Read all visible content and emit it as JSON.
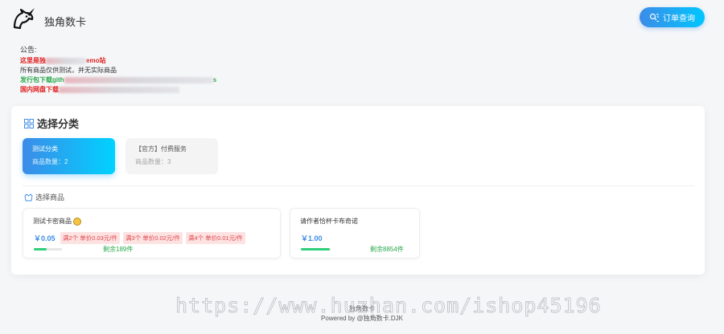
{
  "header": {
    "site_name": "独角数卡",
    "order_button": "订单查询"
  },
  "notice": {
    "title": "公告:",
    "lines": [
      {
        "start": "这里是独",
        "end": "emo站"
      },
      {
        "start": "所有商品仅供测试，并无实际商品",
        "end": ""
      },
      {
        "start": "发行包下载gith",
        "end": "s"
      },
      {
        "start": "国内网盘下载",
        "end": ""
      }
    ]
  },
  "categories": {
    "title": "选择分类",
    "items": [
      {
        "name": "测试分类",
        "count": "商品数量：2"
      },
      {
        "name": "【官方】付费服务",
        "count": "商品数量：3"
      }
    ]
  },
  "goods": {
    "title": "选择商品",
    "items": [
      {
        "name": "测试卡密商品",
        "price": "￥0.05",
        "tags": [
          "满2个 单价0.03元/件",
          "满3个 单价0.02元/件",
          "满4个 单价0.01元/件"
        ],
        "stock": "剩余189件",
        "stock_level": 0.45
      },
      {
        "name": "请作者恰杯卡布奇诺",
        "price": "￥1.00",
        "tags": [],
        "stock": "剩余8854件",
        "stock_level": 0.97
      }
    ]
  },
  "footer": {
    "line1": "独角数卡",
    "line2": "Powered by @独角数卡.DJK"
  },
  "watermark": "https://www.huzhan.com/ishop45196",
  "colors": {
    "accent": "#3c8ce7",
    "accent_end": "#00c6ff",
    "stock_green": "#2fd07a",
    "notice_red": "#e02020",
    "notice_green": "#2aa84a"
  }
}
